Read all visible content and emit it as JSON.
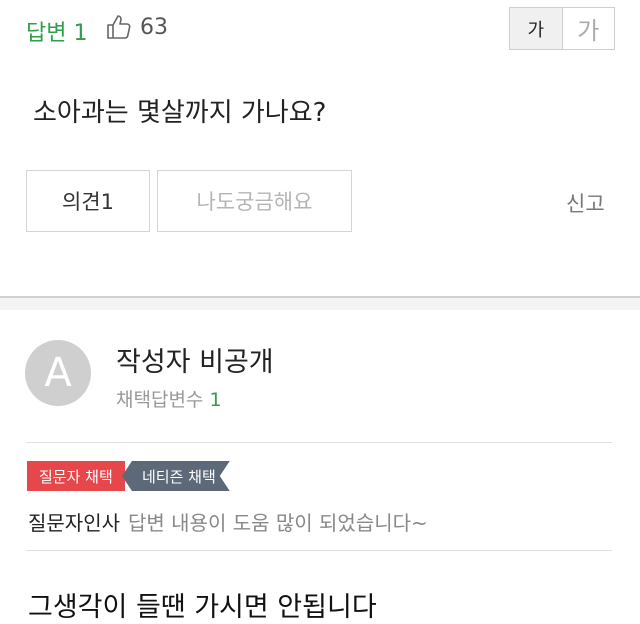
{
  "header": {
    "answer_label": "답변 1",
    "like_count": "63",
    "font_small": "가",
    "font_large": "가"
  },
  "question": {
    "text": "소아과는 몇살까지 가나요?"
  },
  "actions": {
    "opinion_label": "의견1",
    "curious_label": "나도궁금해요",
    "report_label": "신고"
  },
  "author": {
    "avatar_letter": "A",
    "name": "작성자 비공개",
    "adopted_label": "채택답변수",
    "adopted_count": "1"
  },
  "badges": {
    "asker": "질문자 채택",
    "netizen": "네티즌 채택"
  },
  "thanks": {
    "label": "질문자인사",
    "message": "답변 내용이 도움 많이 되었습니다~"
  },
  "answer": {
    "text": "그생각이 들땐 가시면 안됩니다"
  },
  "colors": {
    "accent_green": "#2e9f4a",
    "badge_red": "#e5474b",
    "badge_gray": "#5d6878"
  }
}
